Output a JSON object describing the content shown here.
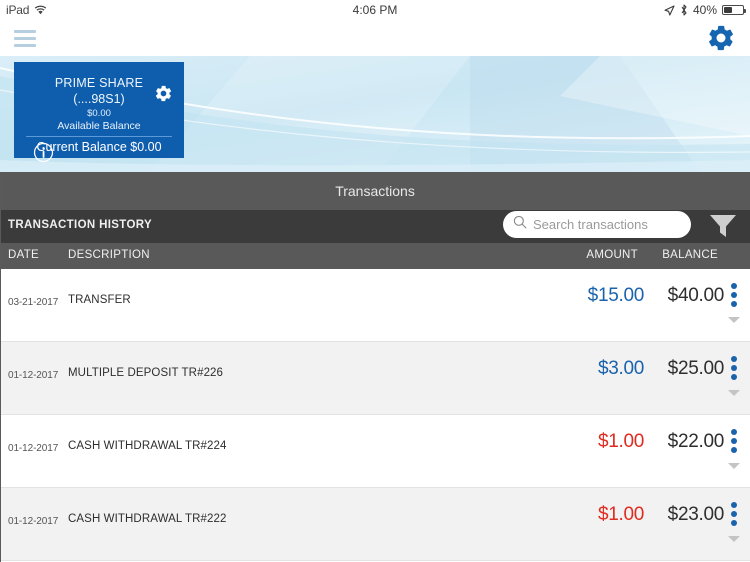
{
  "statusbar": {
    "carrier": "iPad",
    "wifi_icon": "wifi-icon",
    "time": "4:06 PM",
    "location_icon": "location-arrow-icon",
    "bluetooth_icon": "bluetooth-icon",
    "battery_percent": "40%",
    "battery_icon": "battery-icon"
  },
  "navbar": {
    "menu_icon": "hamburger-menu-icon",
    "settings_icon": "gear-icon"
  },
  "account_card": {
    "info_icon": "info-circle-icon",
    "settings_icon": "gear-icon",
    "name": "PRIME SHARE",
    "number": "(....98S1)",
    "available_amount": "$0.00",
    "available_label": "Available Balance",
    "current_balance": "Current Balance $0.00"
  },
  "section": {
    "title": "Transactions",
    "history_label": "TRANSACTION HISTORY"
  },
  "search": {
    "icon": "search-icon",
    "placeholder": "Search transactions",
    "value": ""
  },
  "filter": {
    "icon": "filter-funnel-icon"
  },
  "columns": {
    "date": "DATE",
    "description": "DESCRIPTION",
    "amount": "AMOUNT",
    "balance": "BALANCE"
  },
  "colors": {
    "brand_blue": "#0f5eae",
    "credit_blue": "#1b62ad",
    "debit_red": "#e02b20",
    "bar_gray": "#595959",
    "history_bar": "#3b3b3b"
  },
  "transactions": [
    {
      "date": "03-21-2017",
      "description": "TRANSFER",
      "amount": "$15.00",
      "amount_type": "credit",
      "balance": "$40.00",
      "menu_icon": "more-vertical-icon",
      "expand_icon": "chevron-down-icon"
    },
    {
      "date": "01-12-2017",
      "description": "MULTIPLE DEPOSIT TR#226",
      "amount": "$3.00",
      "amount_type": "credit",
      "balance": "$25.00",
      "menu_icon": "more-vertical-icon",
      "expand_icon": "chevron-down-icon"
    },
    {
      "date": "01-12-2017",
      "description": "CASH WITHDRAWAL TR#224",
      "amount": "$1.00",
      "amount_type": "debit",
      "balance": "$22.00",
      "menu_icon": "more-vertical-icon",
      "expand_icon": "chevron-down-icon"
    },
    {
      "date": "01-12-2017",
      "description": "CASH WITHDRAWAL TR#222",
      "amount": "$1.00",
      "amount_type": "debit",
      "balance": "$23.00",
      "menu_icon": "more-vertical-icon",
      "expand_icon": "chevron-down-icon"
    }
  ]
}
